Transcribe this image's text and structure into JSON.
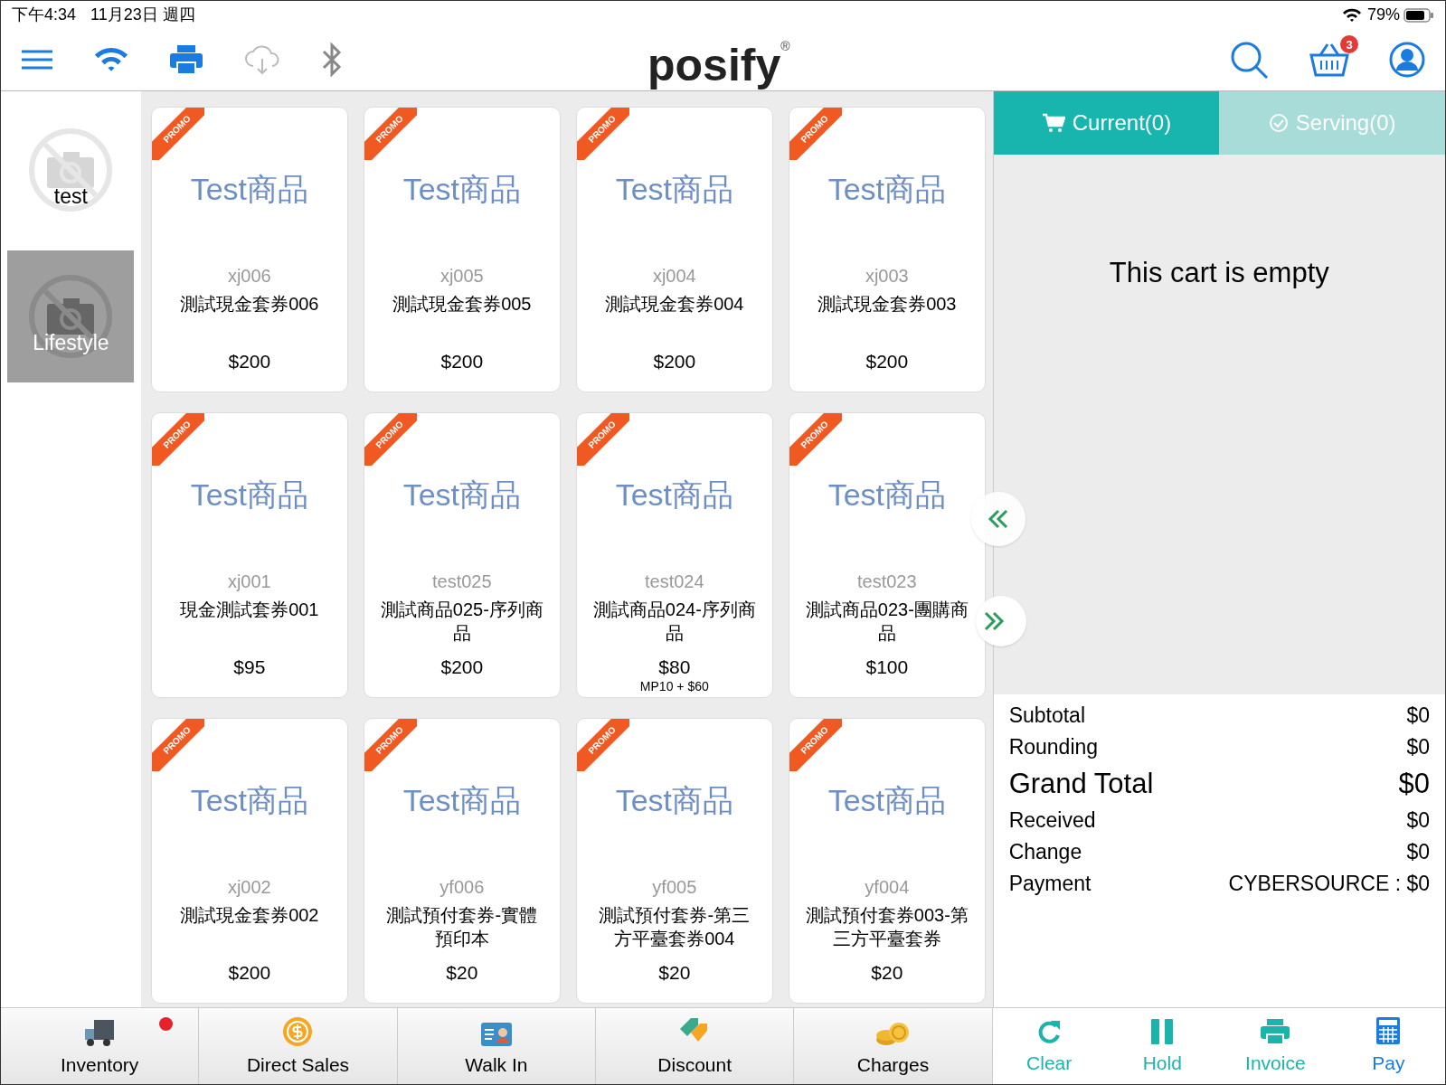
{
  "status_bar": {
    "time": "下午4:34",
    "date": "11月23日 週四",
    "battery": "79%"
  },
  "toolbar": {
    "logo": "posify",
    "logo_mark": "®",
    "cart_badge": "3"
  },
  "categories": [
    {
      "label": "test",
      "selected": false
    },
    {
      "label": "Lifestyle",
      "selected": true
    }
  ],
  "products": [
    {
      "badge": "PROMO",
      "image_text": "Test商品",
      "code": "xj006",
      "name": "測試現金套券006",
      "price": "$200"
    },
    {
      "badge": "PROMO",
      "image_text": "Test商品",
      "code": "xj005",
      "name": "測試現金套券005",
      "price": "$200"
    },
    {
      "badge": "PROMO",
      "image_text": "Test商品",
      "code": "xj004",
      "name": "測試現金套券004",
      "price": "$200"
    },
    {
      "badge": "PROMO",
      "image_text": "Test商品",
      "code": "xj003",
      "name": "測試現金套券003",
      "price": "$200"
    },
    {
      "badge": "PROMO",
      "image_text": "Test商品",
      "code": "xj001",
      "name": "現金測試套券001",
      "price": "$95"
    },
    {
      "badge": "PROMO",
      "image_text": "Test商品",
      "code": "test025",
      "name": "測試商品025-序列商品",
      "price": "$200"
    },
    {
      "badge": "PROMO",
      "image_text": "Test商品",
      "code": "test024",
      "name": "測試商品024-序列商品",
      "price": "$80",
      "extra": "MP10 + $60"
    },
    {
      "badge": "PROMO",
      "image_text": "Test商品",
      "code": "test023",
      "name": "測試商品023-團購商品",
      "price": "$100"
    },
    {
      "badge": "PROMO",
      "image_text": "Test商品",
      "code": "xj002",
      "name": "測試現金套券002",
      "price": "$200"
    },
    {
      "badge": "PROMO",
      "image_text": "Test商品",
      "code": "yf006",
      "name": "測試預付套券-實體預印本",
      "price": "$20"
    },
    {
      "badge": "PROMO",
      "image_text": "Test商品",
      "code": "yf005",
      "name": "測試預付套券-第三方平臺套券004",
      "price": "$20"
    },
    {
      "badge": "PROMO",
      "image_text": "Test商品",
      "code": "yf004",
      "name": "測試預付套券003-第三方平臺套券",
      "price": "$20"
    }
  ],
  "cart": {
    "tabs": [
      {
        "label": "Current(0)",
        "selected": true
      },
      {
        "label": "Serving(0)",
        "selected": false
      }
    ],
    "empty_message": "This cart is empty",
    "summary": [
      {
        "kind": "normal",
        "label": "Subtotal",
        "value": "$0"
      },
      {
        "kind": "normal",
        "label": "Rounding",
        "value": "$0"
      },
      {
        "kind": "grand",
        "label": "Grand Total",
        "value": "$0"
      },
      {
        "kind": "normal",
        "label": "Received",
        "value": "$0"
      },
      {
        "kind": "normal",
        "label": "Change",
        "value": "$0"
      },
      {
        "kind": "normal",
        "label": "Payment",
        "value": "CYBERSOURCE : $0"
      }
    ]
  },
  "bottom_actions": [
    {
      "label": "Inventory",
      "alert": true
    },
    {
      "label": "Direct Sales",
      "alert": false
    },
    {
      "label": "Walk In",
      "alert": false
    },
    {
      "label": "Discount",
      "alert": false
    },
    {
      "label": "Charges",
      "alert": false
    }
  ],
  "cart_actions": [
    {
      "label": "Clear",
      "color": "#1bb3ab"
    },
    {
      "label": "Hold",
      "color": "#1bb3ab"
    },
    {
      "label": "Invoice",
      "color": "#1bb3ab"
    },
    {
      "label": "Pay",
      "color": "#1a7be0"
    }
  ]
}
